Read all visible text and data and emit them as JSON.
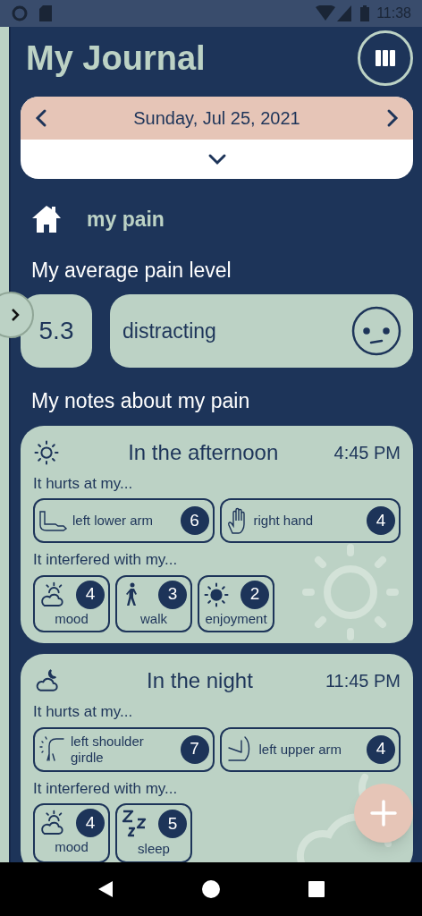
{
  "status_bar": {
    "time": "11:38"
  },
  "header": {
    "title": "My Journal"
  },
  "date_bar": {
    "date": "Sunday, Jul 25, 2021"
  },
  "section": {
    "title": "my pain"
  },
  "average": {
    "heading": "My average pain level",
    "value": "5.3",
    "label": "distracting"
  },
  "notes_heading": "My notes about my pain",
  "entries": [
    {
      "kind": "afternoon",
      "title": "In the afternoon",
      "time": "4:45 PM",
      "hurts_label": "It hurts at my...",
      "locations": [
        {
          "kind": "lower-arm",
          "name": "left lower arm",
          "rating": "6"
        },
        {
          "kind": "hand",
          "name": "right hand",
          "rating": "4"
        }
      ],
      "interfered_label": "It interfered with my...",
      "activities": [
        {
          "kind": "mood",
          "name": "mood",
          "rating": "4"
        },
        {
          "kind": "walk",
          "name": "walk",
          "rating": "3"
        },
        {
          "kind": "enjoyment",
          "name": "enjoyment",
          "rating": "2"
        }
      ]
    },
    {
      "kind": "night",
      "title": "In the night",
      "time": "11:45 PM",
      "hurts_label": "It hurts at my...",
      "locations": [
        {
          "kind": "shoulder",
          "name": "left shoulder girdle",
          "rating": "7"
        },
        {
          "kind": "upper-arm",
          "name": "left upper arm",
          "rating": "4"
        }
      ],
      "interfered_label": "It interfered with my...",
      "activities": [
        {
          "kind": "mood",
          "name": "mood",
          "rating": "4"
        },
        {
          "kind": "sleep",
          "name": "sleep",
          "rating": "5"
        }
      ]
    }
  ]
}
